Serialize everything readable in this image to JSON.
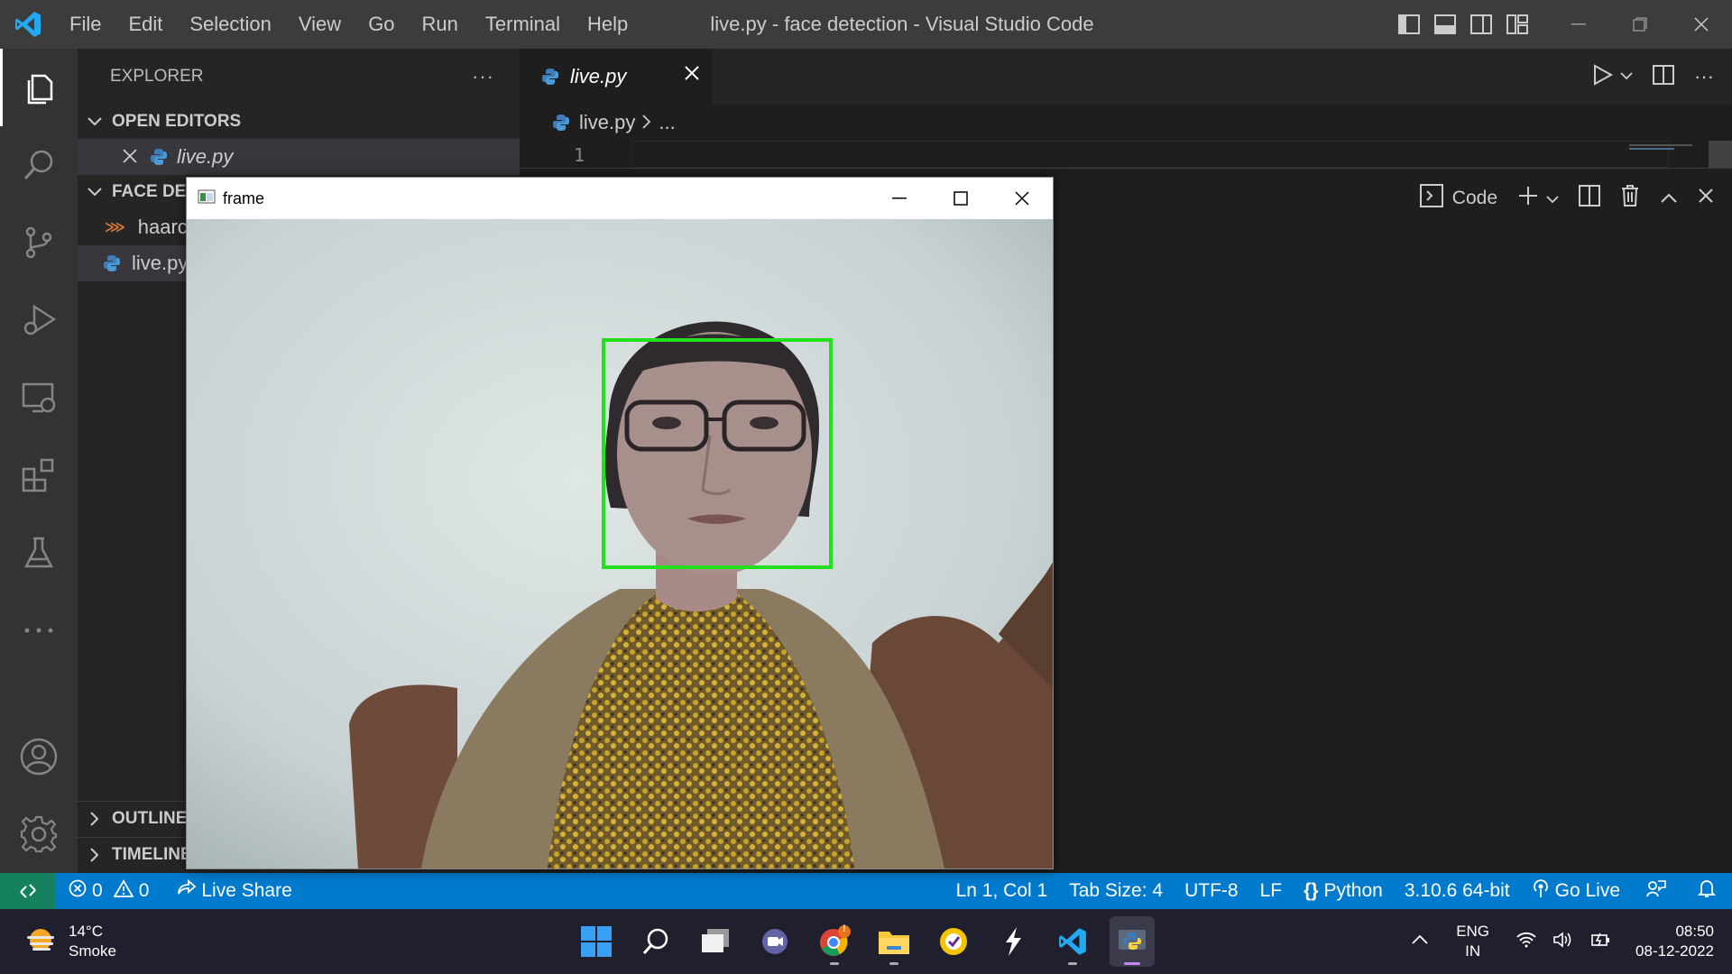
{
  "titlebar": {
    "menu": [
      "File",
      "Edit",
      "Selection",
      "View",
      "Go",
      "Run",
      "Terminal",
      "Help"
    ],
    "title": "live.py - face detection - Visual Studio Code"
  },
  "sidebar": {
    "header": "EXPLORER",
    "open_editors_label": "OPEN EDITORS",
    "open_editor_file": "live.py",
    "folder_label": "FACE DET",
    "files": [
      "haarca",
      "live.py"
    ],
    "outline_label": "OUTLINE",
    "timeline_label": "TIMELINE"
  },
  "editor": {
    "tab_label": "live.py",
    "breadcrumb_file": "live.py",
    "breadcrumb_more": "...",
    "line_number": "1",
    "panel_code_label": "Code"
  },
  "frame_window": {
    "title": "frame",
    "detection_color": "#22e01c"
  },
  "statusbar": {
    "errors": "0",
    "warnings": "0",
    "live_share": "Live Share",
    "cursor": "Ln 1, Col 1",
    "tab_size": "Tab Size: 4",
    "encoding": "UTF-8",
    "eol": "LF",
    "language": "Python",
    "interpreter": "3.10.6 64-bit",
    "go_live": "Go Live"
  },
  "taskbar": {
    "temperature": "14°C",
    "condition": "Smoke",
    "lang_top": "ENG",
    "lang_bottom": "IN",
    "time": "08:50",
    "date": "08-12-2022",
    "chrome_badge": "!"
  },
  "colors": {
    "accent": "#007acc",
    "remote": "#16825d",
    "titlebar": "#3c3c3c"
  }
}
